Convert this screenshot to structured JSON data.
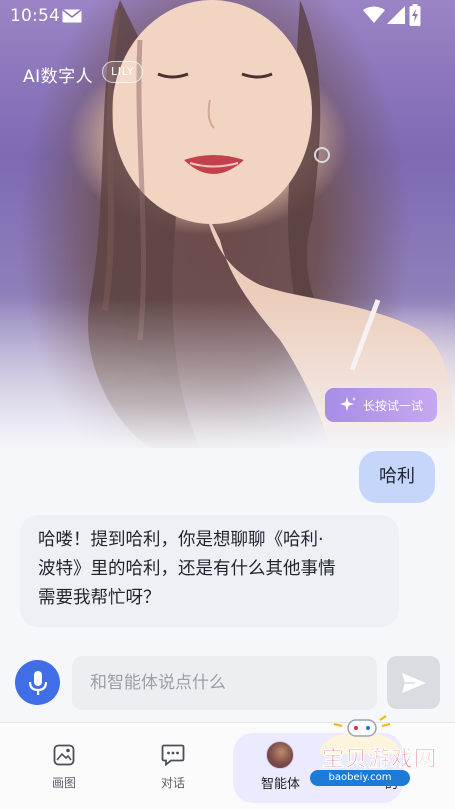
{
  "status_bar": {
    "time": "10:54"
  },
  "header": {
    "title": "AI数字人",
    "name_badge": "LILY"
  },
  "hero": {
    "hint_label": "长按试一试"
  },
  "chat": {
    "user_message": "哈利",
    "bot_message": "哈喽！提到哈利，你是想聊聊《哈利·\n波特》里的哈利，还是有什么其他事情\n需要我帮忙呀？"
  },
  "input": {
    "placeholder": "和智能体说点什么"
  },
  "bottom_nav": {
    "items": [
      {
        "label": "画图",
        "icon": "image-icon"
      },
      {
        "label": "对话",
        "icon": "chat-icon"
      },
      {
        "label": "智能体",
        "icon": "agent-avatar"
      },
      {
        "label": "的",
        "icon": "user-icon"
      }
    ]
  },
  "watermark": {
    "brand": "宝贝游戏网",
    "url": "baobeiy.com"
  },
  "colors": {
    "accent": "#3f6ee6",
    "user_bubble": "#c6d6fb",
    "bot_bubble": "#eef0f5",
    "hint_chip": "#b399ea"
  }
}
